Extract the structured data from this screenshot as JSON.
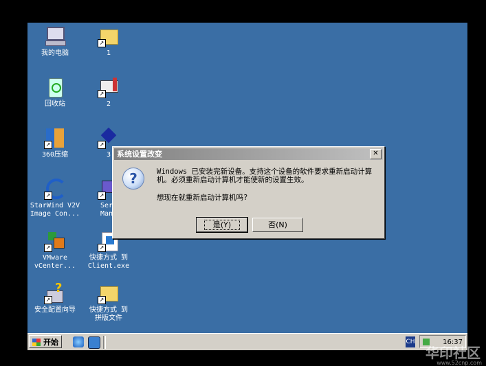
{
  "desktop": {
    "icons": [
      {
        "label": "我的电脑",
        "icon": "my-computer-icon"
      },
      {
        "label": "1",
        "icon": "folder-shortcut-icon"
      },
      {
        "label": "回收站",
        "icon": "recycle-bin-icon"
      },
      {
        "label": "2",
        "icon": "printer-shortcut-icon"
      },
      {
        "label": "360压缩",
        "icon": "360zip-shortcut-icon"
      },
      {
        "label": "3",
        "icon": "shortcut-icon"
      },
      {
        "label": "StarWind V2V\nImage Con...",
        "icon": "starwind-shortcut-icon"
      },
      {
        "label": "Serv\nMana",
        "icon": "server-manager-shortcut-icon"
      },
      {
        "label": "VMware\nvCenter...",
        "icon": "vmware-shortcut-icon"
      },
      {
        "label": "快捷方式 到\nClient.exe",
        "icon": "client-exe-shortcut-icon"
      },
      {
        "label": "安全配置向导",
        "icon": "security-wizard-icon"
      },
      {
        "label": "快捷方式 到\n拼版文件",
        "icon": "folder-shortcut-icon"
      }
    ]
  },
  "dialog": {
    "title": "系统设置改变",
    "close_label": "✕",
    "message": "Windows 已安装完新设备。支持这个设备的软件要求重新启动计算机。必须重新启动计算机才能使新的设置生效。",
    "question": "想现在就重新启动计算机吗?",
    "yes_label": "是(Y)",
    "no_label": "否(N)"
  },
  "taskbar": {
    "start_label": "开始",
    "language": "CH",
    "clock": "16:37"
  },
  "watermark": {
    "text": "华印社区",
    "url": "www.52cnp.com"
  },
  "colors": {
    "desktop": "#3a6ea5",
    "dialog_bg": "#d4d0c8"
  }
}
